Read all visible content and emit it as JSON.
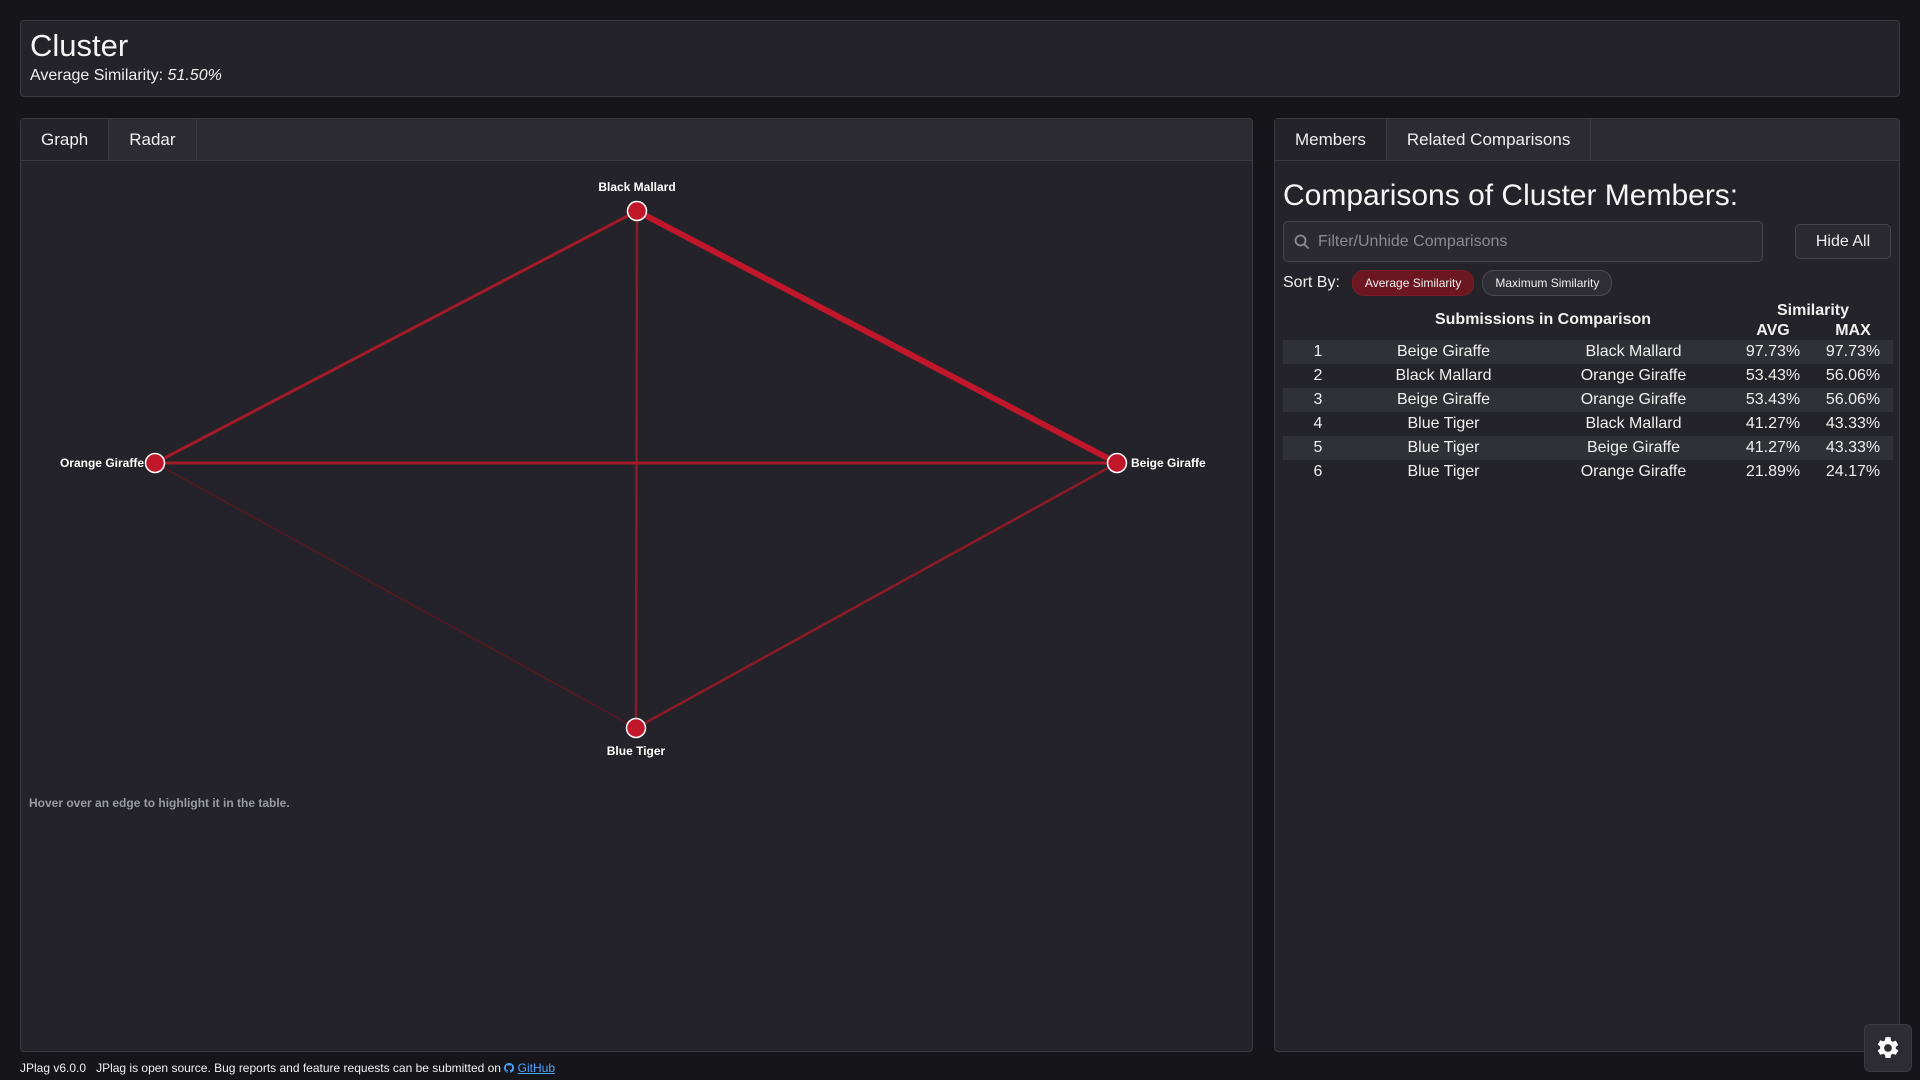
{
  "header": {
    "title": "Cluster",
    "avg_label": "Average Similarity:",
    "avg_value": "51.50%"
  },
  "left_tabs": [
    "Graph",
    "Radar"
  ],
  "graph": {
    "nodes": [
      "Black Mallard",
      "Orange Giraffe",
      "Beige Giraffe",
      "Blue Tiger"
    ],
    "hint": "Hover over an edge to highlight it in the table."
  },
  "right_tabs": [
    "Members",
    "Related Comparisons"
  ],
  "members": {
    "title": "Comparisons of Cluster Members:",
    "filter_placeholder": "Filter/Unhide Comparisons",
    "hide_all": "Hide All",
    "sort_by": "Sort By:",
    "sort_options": [
      "Average Similarity",
      "Maximum Similarity"
    ],
    "table": {
      "header_submissions": "Submissions in Comparison",
      "header_similarity": "Similarity",
      "header_avg": "AVG",
      "header_max": "MAX",
      "rows": [
        {
          "n": "1",
          "a": "Beige Giraffe",
          "b": "Black Mallard",
          "avg": "97.73%",
          "max": "97.73%"
        },
        {
          "n": "2",
          "a": "Black Mallard",
          "b": "Orange Giraffe",
          "avg": "53.43%",
          "max": "56.06%"
        },
        {
          "n": "3",
          "a": "Beige Giraffe",
          "b": "Orange Giraffe",
          "avg": "53.43%",
          "max": "56.06%"
        },
        {
          "n": "4",
          "a": "Blue Tiger",
          "b": "Black Mallard",
          "avg": "41.27%",
          "max": "43.33%"
        },
        {
          "n": "5",
          "a": "Blue Tiger",
          "b": "Beige Giraffe",
          "avg": "41.27%",
          "max": "43.33%"
        },
        {
          "n": "6",
          "a": "Blue Tiger",
          "b": "Orange Giraffe",
          "avg": "21.89%",
          "max": "24.17%"
        }
      ]
    }
  },
  "footer": {
    "version": "JPlag v6.0.0",
    "text": "JPlag is open source. Bug reports and feature requests can be submitted on",
    "link": "GitHub"
  },
  "colors": {
    "accent": "#c0172b",
    "edge": "#8e1a26"
  },
  "icons": [
    "search-icon",
    "gear-icon",
    "github-icon"
  ]
}
